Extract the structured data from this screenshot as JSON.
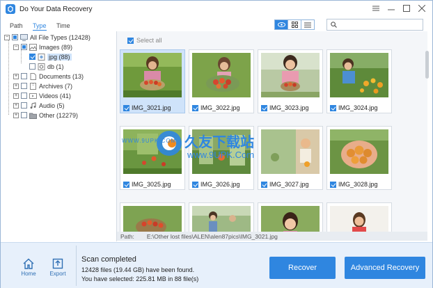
{
  "window": {
    "title": "Do Your Data Recovery"
  },
  "tabs": [
    {
      "label": "Path"
    },
    {
      "label": "Type"
    },
    {
      "label": "Time"
    }
  ],
  "active_tab": "Type",
  "search": {
    "placeholder": ""
  },
  "tree": {
    "root": "All File Types (12428)",
    "images": "Images (89)",
    "jpg": "jpg (88)",
    "db": "db (1)",
    "documents": "Documents (13)",
    "archives": "Archives (7)",
    "videos": "Videos (41)",
    "audio": "Audio (5)",
    "other": "Other (12279)"
  },
  "grid": {
    "select_all": "Select all",
    "items": [
      {
        "name": "IMG_3021.jpg",
        "selected": true
      },
      {
        "name": "IMG_3022.jpg",
        "selected": false
      },
      {
        "name": "IMG_3023.jpg",
        "selected": false
      },
      {
        "name": "IMG_3024.jpg",
        "selected": false
      },
      {
        "name": "IMG_3025.jpg",
        "selected": false
      },
      {
        "name": "IMG_3026.jpg",
        "selected": false
      },
      {
        "name": "IMG_3027.jpg",
        "selected": false
      },
      {
        "name": "IMG_3028.jpg",
        "selected": false
      }
    ]
  },
  "path": {
    "label": "Path:",
    "value": "E:\\Other lost files\\ALEN\\alen87pics\\IMG_3021.jpg"
  },
  "watermark": {
    "brand": "久友下载站",
    "url": "www.9UPK.Com",
    "left_text": "WWW.9UPK.COM"
  },
  "bottom": {
    "home": "Home",
    "export": "Export",
    "status_title": "Scan completed",
    "found_line": "12428 files (19.44 GB) have been found.",
    "selected_line": "You have selected: 225.81 MB in 88 file(s)",
    "recover": "Recover",
    "advanced_recovery": "Advanced Recovery"
  },
  "colors": {
    "accent": "#2f86e0",
    "panel": "#e7f0fb"
  }
}
